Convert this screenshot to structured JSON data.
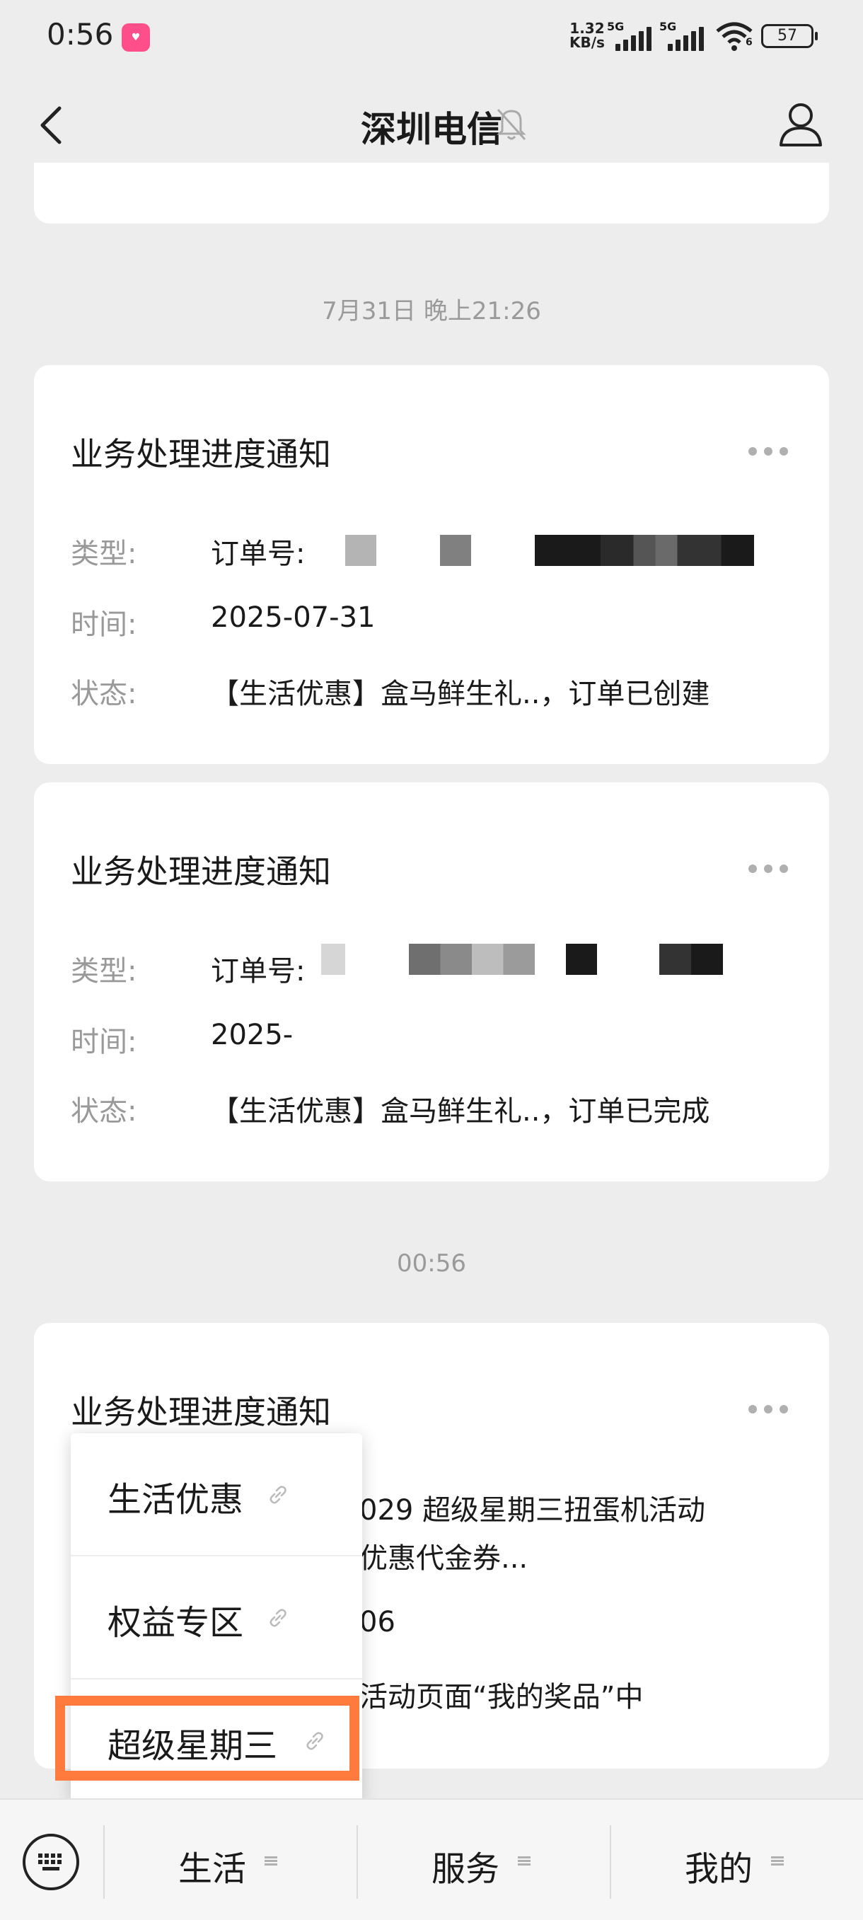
{
  "status": {
    "time": "0:56",
    "app_badge": "拼多多",
    "net_speed_value": "1.32",
    "net_speed_unit": "KB/s",
    "signal1": "5G",
    "signal2": "5G",
    "wifi_sub": "6",
    "battery": "57"
  },
  "header": {
    "title": "深圳电信"
  },
  "stamps": {
    "s1": "7月31日 晚上21:26",
    "s2": "00:56"
  },
  "cards": [
    {
      "title": "业务处理进度通知",
      "type_label": "类型:",
      "type_value": "订单号:",
      "time_label": "时间:",
      "time_value": "2025-07-31",
      "status_label": "状态:",
      "status_value": "【生活优惠】盒马鲜生礼..，订单已创建"
    },
    {
      "title": "业务处理进度通知",
      "type_label": "类型:",
      "type_value": "订单号:",
      "time_label": "时间:",
      "time_value": "2025-",
      "status_label": "状态:",
      "status_value": "【生活优惠】盒马鲜生礼..，订单已完成"
    },
    {
      "title": "业务处理进度通知",
      "line1": "029 超级星期三扭蛋机活动",
      "line2": "优惠代金券...",
      "line3": "06",
      "line4": "活动页面“我的奖品”中"
    }
  ],
  "popup_menu": {
    "items": [
      "生活优惠",
      "权益专区",
      "超级星期三"
    ]
  },
  "bottom_menu": {
    "tabs": [
      "生活",
      "服务",
      "我的"
    ]
  },
  "colors": {
    "highlight": "#ff7a3d",
    "background": "#ededed",
    "card": "#ffffff"
  }
}
